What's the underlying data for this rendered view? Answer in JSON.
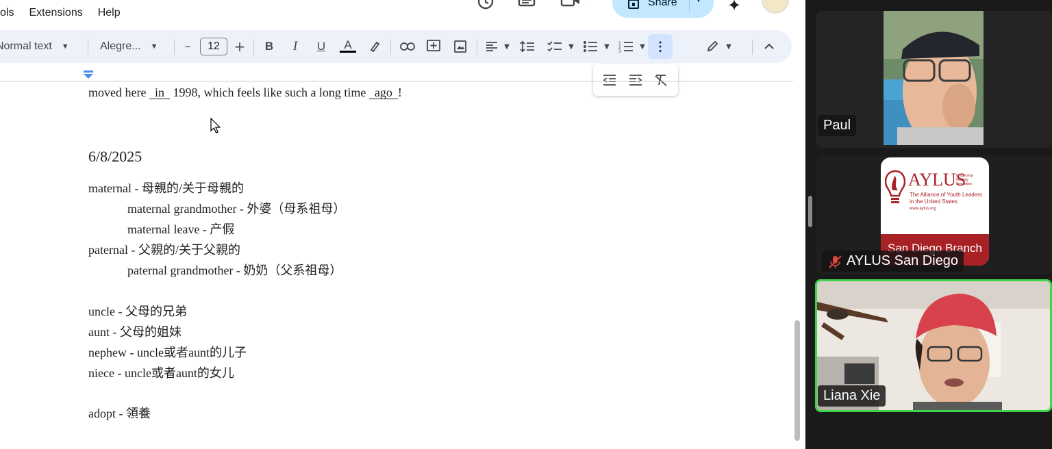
{
  "menu": {
    "tools": "ols",
    "extensions": "Extensions",
    "help": "Help"
  },
  "header": {
    "share_label": "Share",
    "icons": [
      "history-icon",
      "comment-icon",
      "meet-icon",
      "gemini-icon",
      "avatar"
    ]
  },
  "toolbar": {
    "style_value": "Normal text",
    "font_value": "Alegre...",
    "font_size": "12",
    "decrease_symbol": "–",
    "increase_symbol": "+",
    "bold": "B",
    "italic": "I",
    "underline": "U",
    "text_color": "A"
  },
  "document": {
    "lines": [
      {
        "pre": "moved here ",
        "blank1": "in",
        "mid": " 1998, which feels like such a long time ",
        "blank2": "ago",
        "post": "!"
      },
      {
        "text": "6/8/2025"
      },
      {
        "text": "maternal - 母親的/关于母親的"
      },
      {
        "text": "maternal grandmother - 外婆（母系祖母）"
      },
      {
        "text": "maternal leave - 产假"
      },
      {
        "text": "paternal - 父親的/关于父親的"
      },
      {
        "text": "paternal grandmother - 奶奶（父系祖母）"
      },
      {
        "text": "uncle - 父母的兄弟"
      },
      {
        "text": "aunt - 父母的姐妹"
      },
      {
        "text": "nephew - uncle或者aunt的儿子"
      },
      {
        "text": "niece - uncle或者aunt的女儿"
      },
      {
        "text": "adopt - 領養"
      }
    ]
  },
  "participants": [
    {
      "name": "Paul",
      "muted": false
    },
    {
      "name": "AYLUS San Diego",
      "muted": true
    },
    {
      "name": "Liana Xie",
      "muted": false,
      "active_speaker": true
    }
  ],
  "aylus_logo": {
    "title": "AYLUS",
    "right_lines": [
      "Leadership",
      "Integrity",
      "Innovation"
    ],
    "tagline": "The Alliance of Youth Leaders in the United States",
    "url": "www.aylus.org",
    "banner": "San Diego Branch"
  },
  "colors": {
    "accent_speaker": "#3fd54a",
    "share_bg": "#c2e7ff",
    "toolbar_bg": "#edf2fa",
    "aylus_red": "#a82125"
  }
}
